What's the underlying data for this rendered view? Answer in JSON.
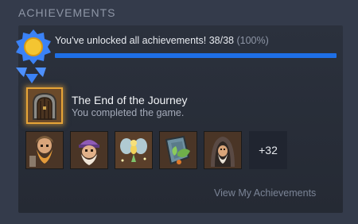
{
  "section": {
    "title": "ACHIEVEMENTS"
  },
  "progress": {
    "text": "You've unlocked all achievements! 38/38",
    "percent_text": "(100%)",
    "fraction": 1.0,
    "fill_color": "#1e6fe6"
  },
  "featured": {
    "title": "The End of the Journey",
    "description": "You completed the game.",
    "icon": "stone-door-icon"
  },
  "achievements": [
    {
      "icon": "bearded-warrior-icon"
    },
    {
      "icon": "purple-hat-dwarf-icon"
    },
    {
      "icon": "fairy-icon"
    },
    {
      "icon": "leaf-shield-icon"
    },
    {
      "icon": "hooded-elder-icon"
    }
  ],
  "more": {
    "label": "+32"
  },
  "footer": {
    "link": "View My Achievements"
  },
  "colors": {
    "background": "#343b4b",
    "panel": "#2b313d",
    "accent": "#1e6fe6",
    "gold": "#e7a437"
  }
}
